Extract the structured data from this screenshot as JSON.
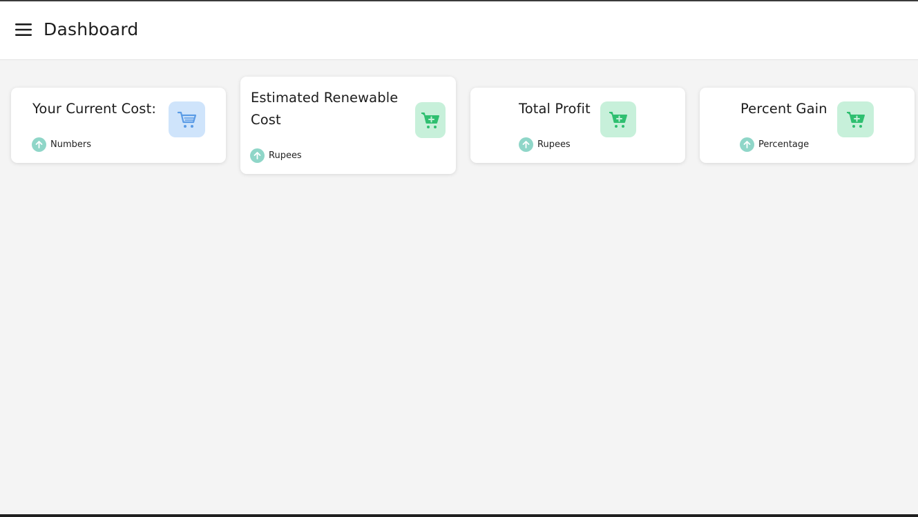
{
  "header": {
    "title": "Dashboard",
    "menu_icon": "hamburger-menu-icon"
  },
  "cards": [
    {
      "title": "Your Current Cost:",
      "subtitle": "Numbers",
      "icon": "shopping-cart-icon",
      "icon_color": "#5a9be6",
      "icon_bg": "#cfe4fb"
    },
    {
      "title": "Estimated Renewable Cost",
      "subtitle": "Rupees",
      "icon": "cart-plus-icon",
      "icon_color": "#2fbf70",
      "icon_bg": "#c7f0da"
    },
    {
      "title": "Total Profit",
      "subtitle": "Rupees",
      "icon": "cart-plus-icon",
      "icon_color": "#2fbf70",
      "icon_bg": "#c7f0da"
    },
    {
      "title": "Percent Gain",
      "subtitle": "Percentage",
      "icon": "cart-plus-icon",
      "icon_color": "#2fbf70",
      "icon_bg": "#c7f0da"
    }
  ],
  "colors": {
    "background": "#f4f4f4",
    "card": "#ffffff",
    "trend_up": "#8fd6c8"
  }
}
